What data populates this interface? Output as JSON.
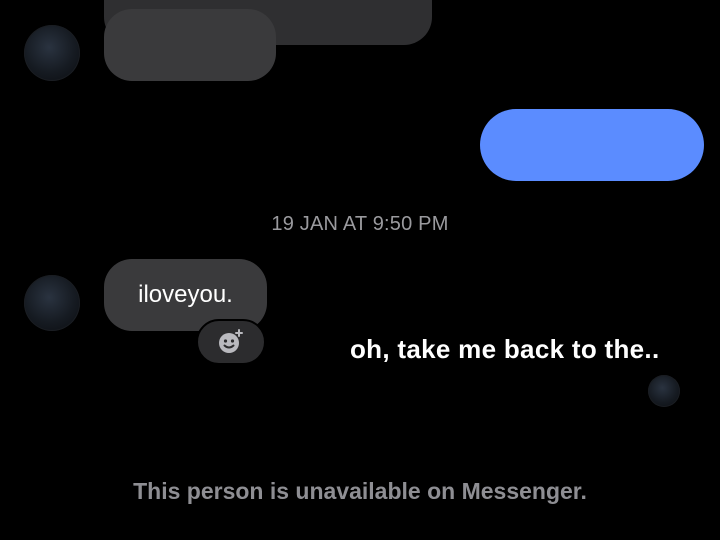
{
  "conversation": {
    "timestamp": "19 JAN AT 9:50 PM",
    "messages": [
      {
        "direction": "incoming",
        "text": ""
      },
      {
        "direction": "incoming",
        "text": ""
      },
      {
        "direction": "outgoing",
        "text": ""
      },
      {
        "direction": "incoming",
        "text": "iloveyou."
      }
    ],
    "reaction_icon": "add-reaction-smiley-icon"
  },
  "overlay": {
    "caption": "oh, take me back to the.."
  },
  "footer": {
    "notice": "This person is unavailable on Messenger."
  },
  "colors": {
    "background": "#000000",
    "incoming_bubble": "#3a3a3c",
    "outgoing_bubble": "#5b8cff",
    "muted_text": "#9a9a9e"
  }
}
